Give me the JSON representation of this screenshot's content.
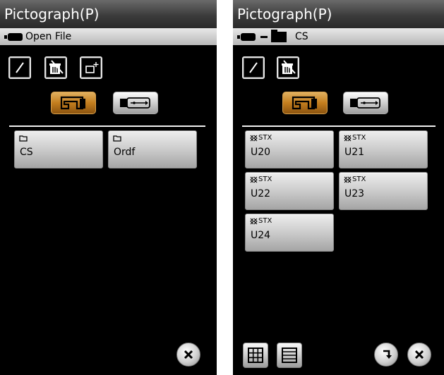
{
  "left_screen": {
    "title": "Pictograph(P)",
    "path_label": "Open File",
    "files": [
      {
        "type": "folder",
        "name": "CS"
      },
      {
        "type": "folder",
        "name": "Ordf"
      }
    ]
  },
  "right_screen": {
    "title": "Pictograph(P)",
    "path_label": "CS",
    "files": [
      {
        "type": "STX",
        "name": "U20"
      },
      {
        "type": "STX",
        "name": "U21"
      },
      {
        "type": "STX",
        "name": "U22"
      },
      {
        "type": "STX",
        "name": "U23"
      },
      {
        "type": "STX",
        "name": "U24"
      }
    ]
  },
  "icons": {
    "rename": "pencil-icon",
    "delete": "trash-icon",
    "new_folder": "new-folder-icon",
    "machine_memory": "sewing-machine-icon",
    "usb": "usb-icon",
    "close": "close-icon",
    "back": "back-arrow-icon",
    "grid_view": "grid-view-icon",
    "list_view": "list-view-icon"
  },
  "colors": {
    "selected_source": "#c47e1e",
    "background": "#000000"
  }
}
